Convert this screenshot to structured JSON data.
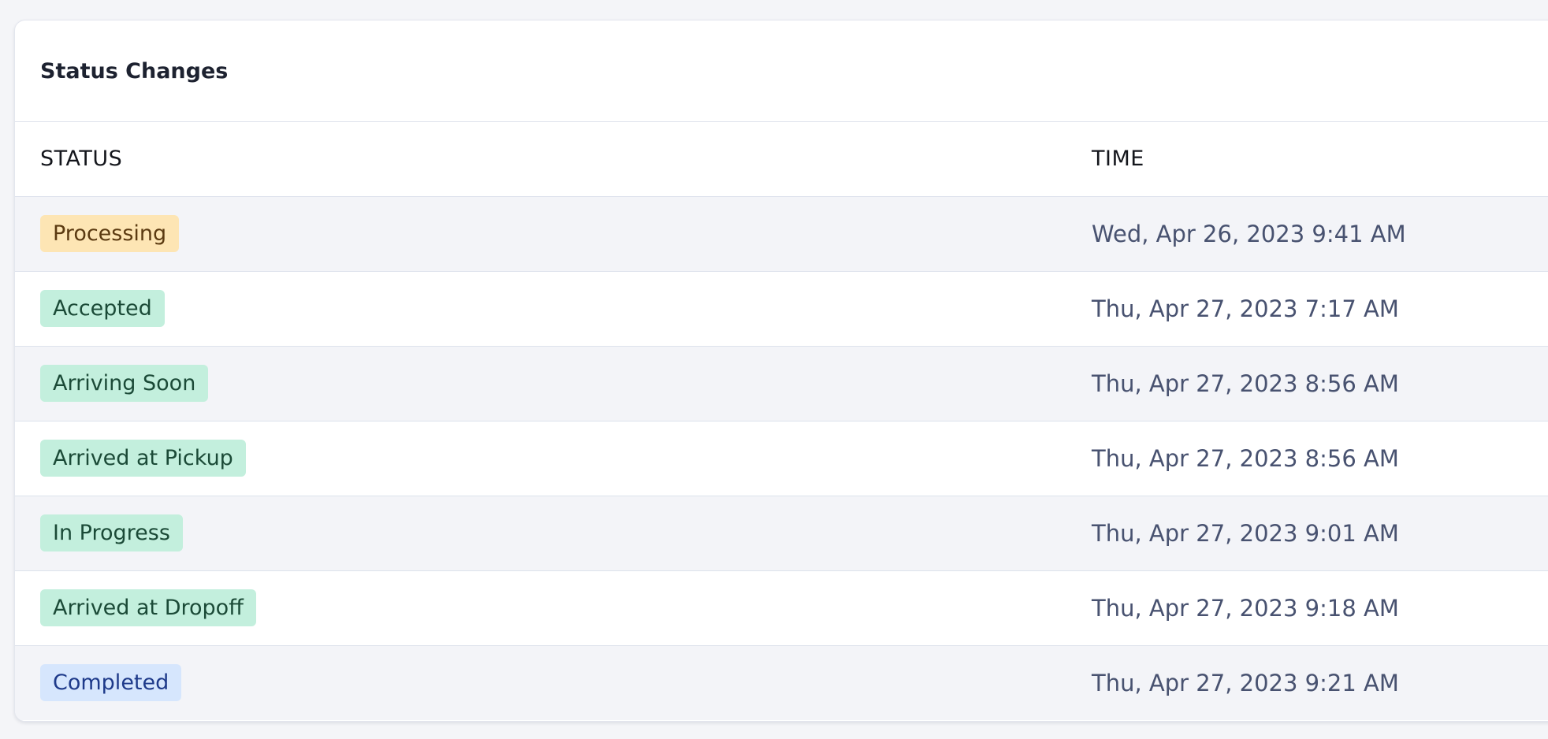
{
  "panel": {
    "title": "Status Changes"
  },
  "table": {
    "columns": {
      "status": "STATUS",
      "time": "TIME"
    },
    "rows": [
      {
        "status": "Processing",
        "time": "Wed, Apr 26, 2023 9:41 AM",
        "badge_color": "#fde5b4"
      },
      {
        "status": "Accepted",
        "time": "Thu, Apr 27, 2023 7:17 AM",
        "badge_color": "#c3efdd"
      },
      {
        "status": "Arriving Soon",
        "time": "Thu, Apr 27, 2023 8:56 AM",
        "badge_color": "#c3efdd"
      },
      {
        "status": "Arrived at Pickup",
        "time": "Thu, Apr 27, 2023 8:56 AM",
        "badge_color": "#c3efdd"
      },
      {
        "status": "In Progress",
        "time": "Thu, Apr 27, 2023 9:01 AM",
        "badge_color": "#c3efdd"
      },
      {
        "status": "Arrived at Dropoff",
        "time": "Thu, Apr 27, 2023 9:18 AM",
        "badge_color": "#c3efdd"
      },
      {
        "status": "Completed",
        "time": "Thu, Apr 27, 2023 9:21 AM",
        "badge_color": "#d6e6fd"
      }
    ]
  },
  "colors": {
    "badge_yellow": "#fde5b4",
    "badge_green": "#c3efdd",
    "badge_blue": "#d6e6fd",
    "time_text": "#485270",
    "row_alt": "#f3f4f8"
  }
}
